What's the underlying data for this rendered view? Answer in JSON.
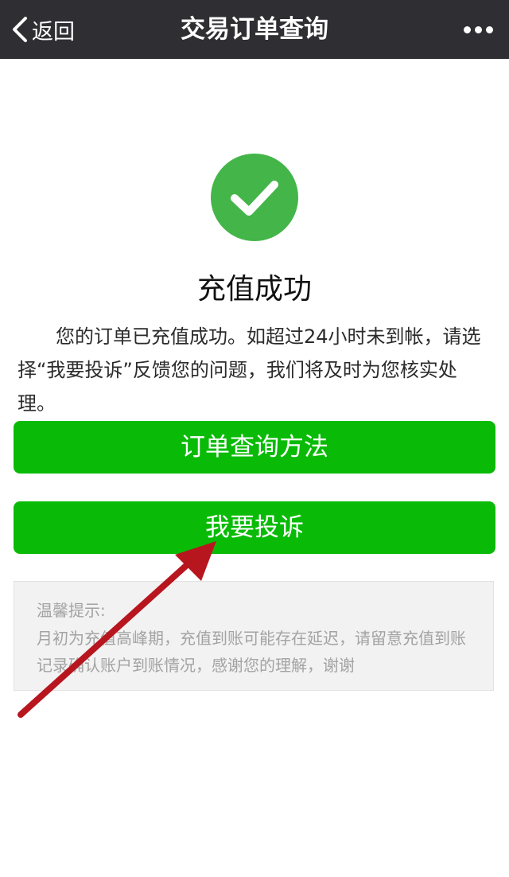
{
  "navbar": {
    "back_label": "返回",
    "title": "交易订单查询",
    "back_icon": "chevron-left-icon",
    "more_icon": "more-dots-icon"
  },
  "result": {
    "icon": "checkmark-circle-icon",
    "title": "充值成功",
    "description": "您的订单已充值成功。如超过24小时未到帐，请选择“我要投诉”反馈您的问题，我们将及时为您核实处理。"
  },
  "buttons": {
    "query_label": "订单查询方法",
    "complain_label": "我要投诉"
  },
  "tips": {
    "title": "温馨提示:",
    "body": "月初为充值高峰期，充值到账可能存在延迟，请留意充值到账记录确认账户到账情况，感谢您的理解，谢谢"
  },
  "colors": {
    "navbar_bg": "#2e2e33",
    "accent_green": "#09bb07",
    "success_icon_green": "#44b549",
    "annotation_arrow": "#b8161f"
  }
}
